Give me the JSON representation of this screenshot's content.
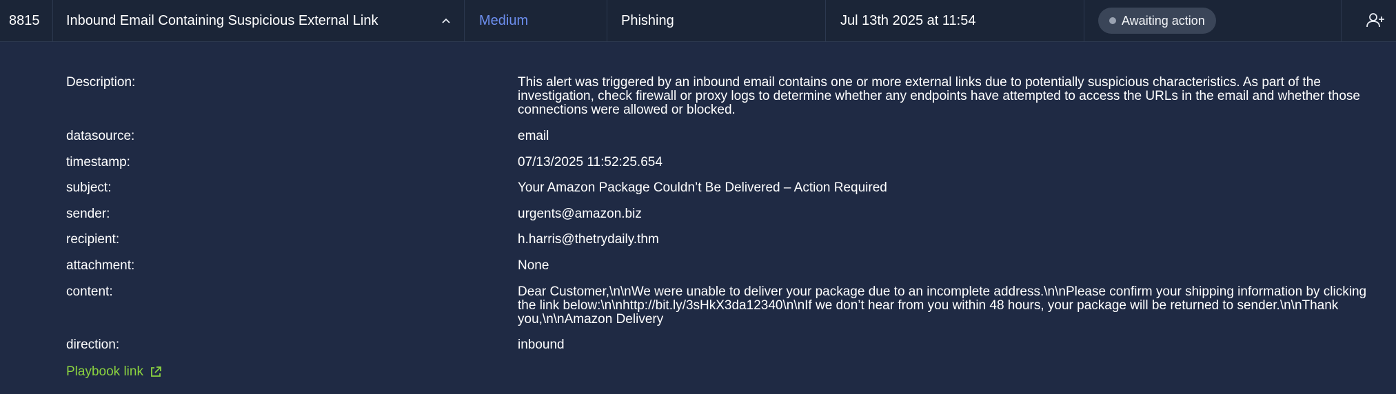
{
  "alert": {
    "id": "8815",
    "title": "Inbound Email Containing Suspicious External Link",
    "severity": "Medium",
    "severity_color": "#6d8ff0",
    "type": "Phishing",
    "time": "Jul 13th 2025 at 11:54",
    "status": "Awaiting action",
    "icons": {
      "collapse": "chevron-up-icon",
      "assign": "add-user-icon",
      "external": "external-link-icon"
    }
  },
  "details": {
    "description_label": "Description:",
    "description_value": "This alert was triggered by an inbound email contains one or more external links due to potentially suspicious characteristics. As part of the investigation, check firewall or proxy logs to determine whether any endpoints have attempted to access the URLs in the email and whether those connections were allowed or blocked.",
    "datasource_label": "datasource:",
    "datasource_value": "email",
    "timestamp_label": "timestamp:",
    "timestamp_value": "07/13/2025 11:52:25.654",
    "subject_label": "subject:",
    "subject_value": "Your Amazon Package Couldn’t Be Delivered – Action Required",
    "sender_label": "sender:",
    "sender_value": "urgents@amazon.biz",
    "recipient_label": "recipient:",
    "recipient_value": "h.harris@thetrydaily.thm",
    "attachment_label": "attachment:",
    "attachment_value": "None",
    "content_label": "content:",
    "content_value": "Dear Customer,\\n\\nWe were unable to deliver your package due to an incomplete address.\\n\\nPlease confirm your shipping information by clicking the link below:\\n\\nhttp://bit.ly/3sHkX3da12340\\n\\nIf we don’t hear from you within 48 hours, your package will be returned to sender.\\n\\nThank you,\\n\\nAmazon Delivery",
    "direction_label": "direction:",
    "direction_value": "inbound",
    "playbook_link": "Playbook link",
    "link_color": "#8bd33f"
  }
}
